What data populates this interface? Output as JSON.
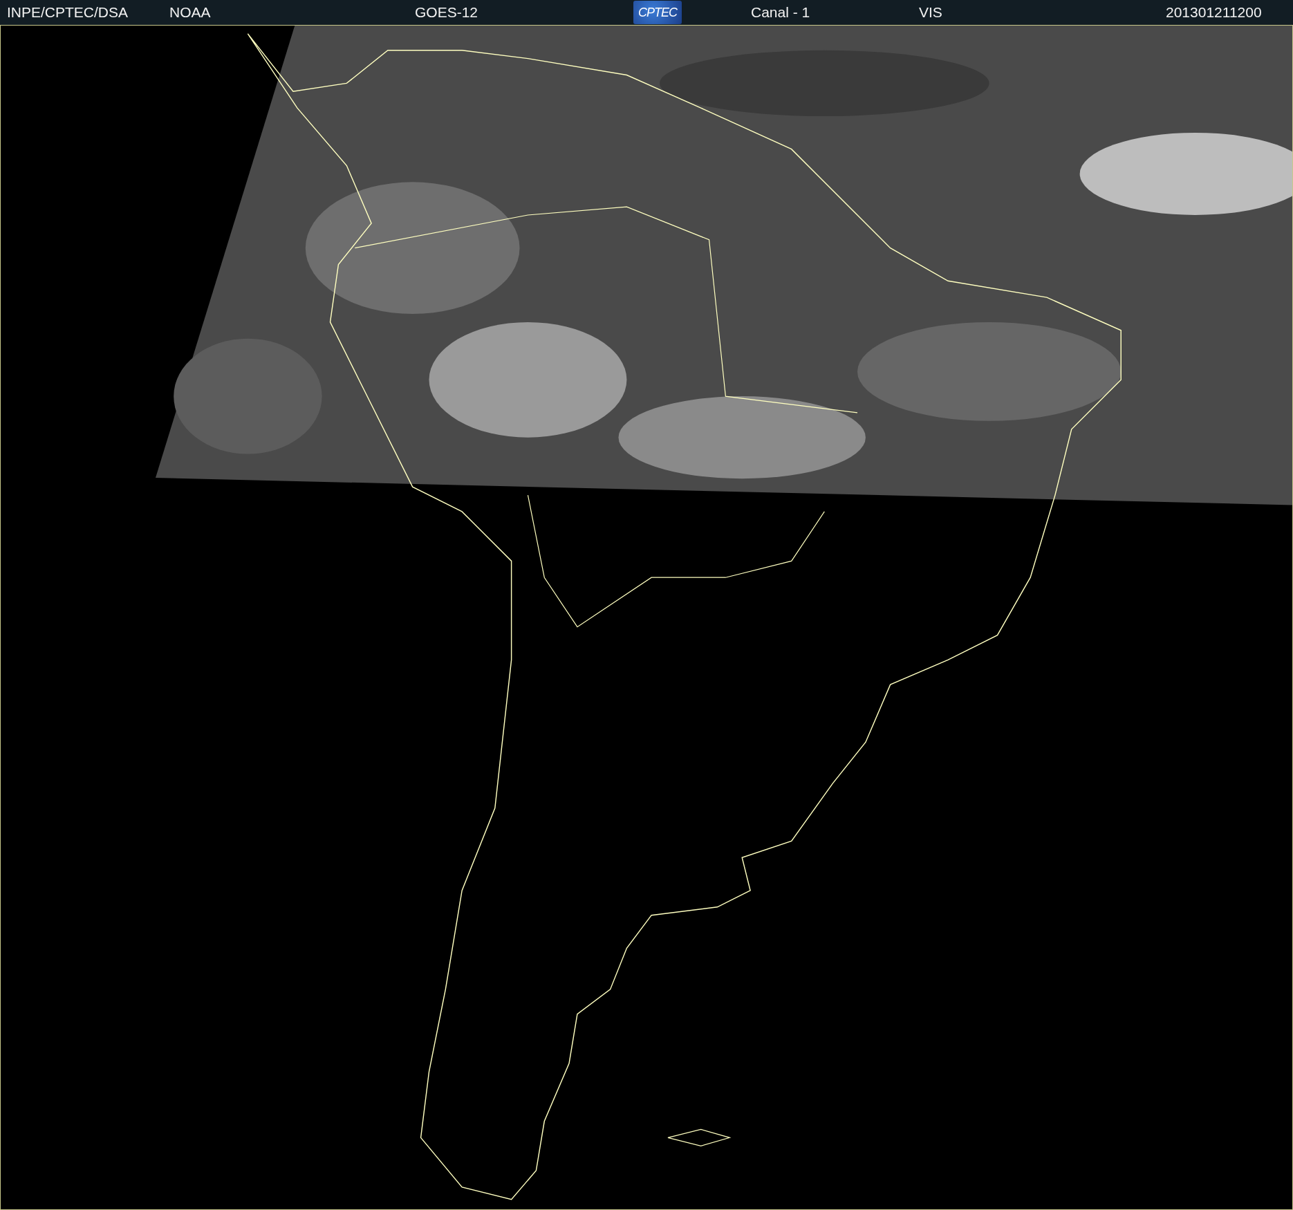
{
  "header": [
    {
      "kind": "text",
      "text": "INPE/CPTEC/DSA"
    },
    {
      "kind": "text",
      "text": "NOAA"
    },
    {
      "kind": "text",
      "text": "GOES-12"
    },
    {
      "kind": "logo",
      "text": "CPTEC"
    },
    {
      "kind": "text",
      "text": "Canal - 1"
    },
    {
      "kind": "text",
      "text": "VIS"
    },
    {
      "kind": "text",
      "text": "201301211200"
    }
  ]
}
